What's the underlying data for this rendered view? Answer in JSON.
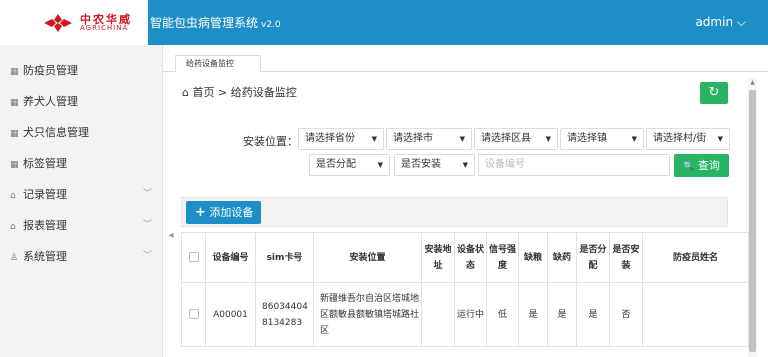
{
  "header": {
    "logo_cn": "中农华威",
    "logo_en": "AGRICHINA",
    "app_title": "智能包虫病管理系统",
    "app_version": "v2.0",
    "user": "admin",
    "user_caret": "⌵",
    "brand_color": "#1e8fc6",
    "logo_color": "#d2141b"
  },
  "sidebar": {
    "items": [
      {
        "label": "防疫员管理",
        "icon": "grid-icon",
        "glyph": "▦"
      },
      {
        "label": "养犬人管理",
        "icon": "grid-icon",
        "glyph": "▦"
      },
      {
        "label": "犬只信息管理",
        "icon": "grid-icon",
        "glyph": "▦"
      },
      {
        "label": "标签管理",
        "icon": "grid-icon",
        "glyph": "▦"
      },
      {
        "label": "记录管理",
        "icon": "home-icon",
        "glyph": "⌂",
        "arrow": "﹀"
      },
      {
        "label": "报表管理",
        "icon": "home-icon",
        "glyph": "⌂",
        "arrow": "﹀"
      },
      {
        "label": "系统管理",
        "icon": "user-icon",
        "glyph": "♙",
        "arrow": "﹀"
      }
    ],
    "collapse_glyph": "◂"
  },
  "tabs": [
    {
      "label": "给药设备监控"
    }
  ],
  "breadcrumb": {
    "home_glyph": "⌂",
    "home": "首页",
    "separator": ">",
    "current": "给药设备监控"
  },
  "refresh_glyph": "↻",
  "filters": {
    "location_label": "安装位置：",
    "province": "请选择省份",
    "city": "请选择市",
    "district": "请选择区县",
    "town": "请选择镇",
    "village": "请选择村/街",
    "assigned": "是否分配",
    "installed": "是否安装",
    "device_placeholder": "设备编号",
    "search_label": "查询",
    "search_glyph": "🔍",
    "caret": "▼"
  },
  "toolbar": {
    "add_label": "添加设备",
    "add_glyph": "+"
  },
  "table": {
    "columns": [
      "",
      "设备编号",
      "sim卡号",
      "安装位置",
      "安装地址",
      "设备状态",
      "信号强度",
      "缺粮",
      "缺药",
      "是否分配",
      "是否安装",
      "防疫员姓名"
    ],
    "rows": [
      [
        "",
        "A00001",
        "860344048134283",
        "新疆维吾尔自治区塔城地区额敏县额敏镇塔城路社区",
        "",
        "运行中",
        "低",
        "是",
        "是",
        "是",
        "否",
        ""
      ]
    ]
  },
  "accent_green": "#28b463"
}
